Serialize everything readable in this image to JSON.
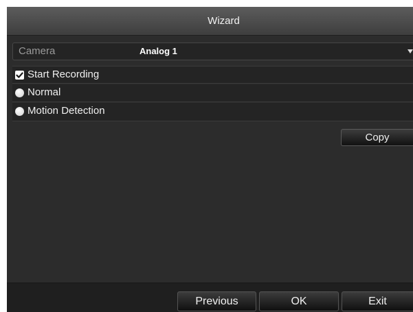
{
  "window": {
    "title": "Wizard"
  },
  "camera": {
    "label": "Camera",
    "value": "Analog 1"
  },
  "options": {
    "start_recording": {
      "label": "Start Recording",
      "checked": true
    },
    "normal": {
      "label": "Normal"
    },
    "motion_detection": {
      "label": "Motion Detection"
    }
  },
  "actions": {
    "copy_label": "Copy"
  },
  "footer": {
    "previous_label": "Previous",
    "ok_label": "OK",
    "exit_label": "Exit"
  },
  "colors": {
    "window_bg": "#2c2c2c",
    "titlebar_top": "#5c5c5c",
    "row_bg": "#242424",
    "text": "#f0f0f0",
    "label_muted": "#9a9a9a"
  },
  "icons": {
    "checkbox": "checkmark-icon",
    "radio": "radio-dot-icon",
    "dropdown": "chevron-down-icon"
  }
}
